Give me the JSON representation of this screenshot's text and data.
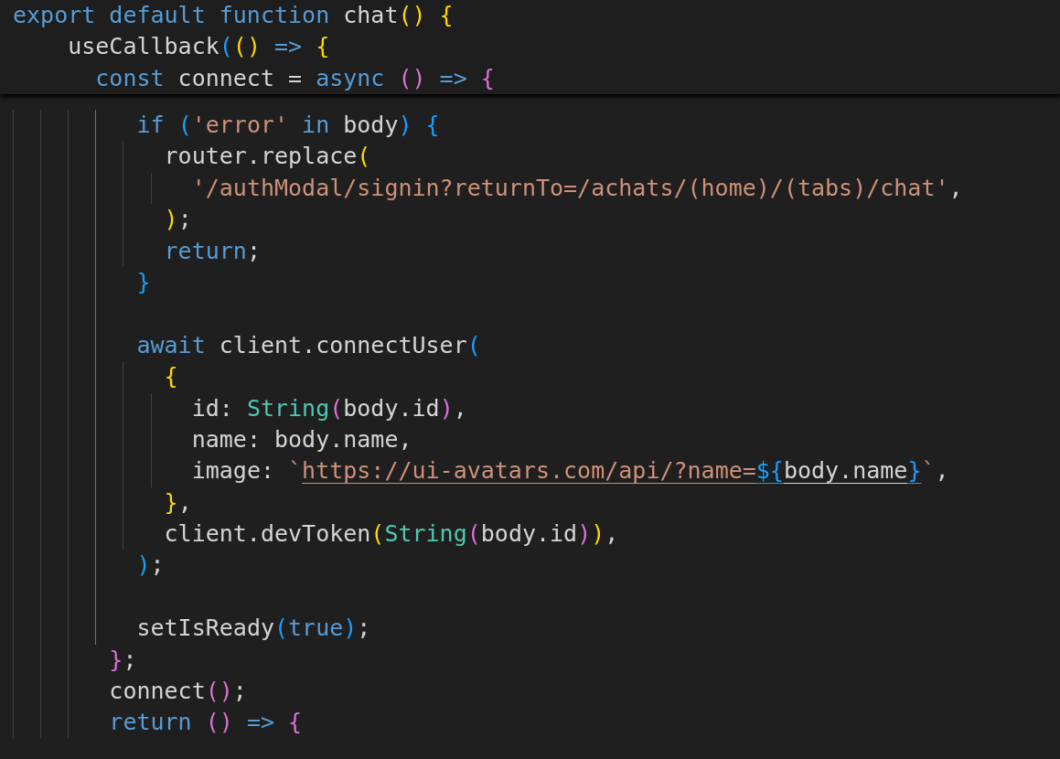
{
  "sticky_lines": [
    {
      "kind": "code",
      "tokens": [
        {
          "kind": "keyword",
          "t": "export default function "
        },
        {
          "kind": "plain",
          "t": "chat"
        },
        {
          "kind": "bracket1",
          "t": "() {"
        }
      ]
    },
    {
      "kind": "code",
      "tokens": [
        {
          "kind": "plain",
          "t": "    useCallback"
        },
        {
          "kind": "bracket3",
          "t": "("
        },
        {
          "kind": "bracket1",
          "t": "()"
        },
        {
          "kind": "keyword",
          "t": " => "
        },
        {
          "kind": "bracket1",
          "t": "{"
        }
      ]
    },
    {
      "kind": "code",
      "tokens": [
        {
          "kind": "keyword",
          "t": "      const "
        },
        {
          "kind": "plain",
          "t": "connect = "
        },
        {
          "kind": "keyword",
          "t": "async "
        },
        {
          "kind": "bracket2",
          "t": "() "
        },
        {
          "kind": "keyword",
          "t": "=> "
        },
        {
          "kind": "bracket2",
          "t": "{"
        }
      ]
    }
  ],
  "code_lines": [
    {
      "kind": "code",
      "tokens": [
        {
          "kind": "keyword",
          "t": "        if "
        },
        {
          "kind": "bracket3",
          "t": "("
        },
        {
          "kind": "string",
          "t": "'error'"
        },
        {
          "kind": "keyword",
          "t": " in "
        },
        {
          "kind": "plain",
          "t": "body"
        },
        {
          "kind": "bracket3",
          "t": ") {"
        }
      ]
    },
    {
      "kind": "code",
      "tokens": [
        {
          "kind": "plain",
          "t": "          router.replace"
        },
        {
          "kind": "bracket1",
          "t": "("
        }
      ]
    },
    {
      "kind": "code",
      "tokens": [
        {
          "kind": "string",
          "t": "            '/authModal/signin?returnTo=/achats/(home)/(tabs)/chat'"
        },
        {
          "kind": "plain",
          "t": ","
        }
      ]
    },
    {
      "kind": "code",
      "tokens": [
        {
          "kind": "bracket1",
          "t": "          )"
        },
        {
          "kind": "plain",
          "t": ";"
        }
      ]
    },
    {
      "kind": "code",
      "tokens": [
        {
          "kind": "keyword",
          "t": "          return"
        },
        {
          "kind": "plain",
          "t": ";"
        }
      ]
    },
    {
      "kind": "code",
      "tokens": [
        {
          "kind": "bracket3",
          "t": "        }"
        }
      ]
    },
    {
      "kind": "blank"
    },
    {
      "kind": "code",
      "tokens": [
        {
          "kind": "keyword",
          "t": "        await "
        },
        {
          "kind": "plain",
          "t": "client.connectUser"
        },
        {
          "kind": "bracket3",
          "t": "("
        }
      ]
    },
    {
      "kind": "code",
      "tokens": [
        {
          "kind": "bracket1",
          "t": "          {"
        }
      ]
    },
    {
      "kind": "code",
      "tokens": [
        {
          "kind": "plain",
          "t": "            id: "
        },
        {
          "kind": "type",
          "t": "String"
        },
        {
          "kind": "bracket2",
          "t": "("
        },
        {
          "kind": "plain",
          "t": "body.id"
        },
        {
          "kind": "bracket2",
          "t": ")"
        },
        {
          "kind": "plain",
          "t": ","
        }
      ]
    },
    {
      "kind": "code",
      "tokens": [
        {
          "kind": "plain",
          "t": "            name: body.name,"
        }
      ]
    },
    {
      "kind": "code",
      "tokens": [
        {
          "kind": "plain",
          "t": "            image: "
        },
        {
          "kind": "string",
          "t": "`"
        },
        {
          "kind": "string",
          "t": "https://ui-avatars.com/api/?name=",
          "link": true
        },
        {
          "kind": "bracket3",
          "t": "${",
          "link": true
        },
        {
          "kind": "plain",
          "t": "body.name",
          "link": true
        },
        {
          "kind": "bracket3",
          "t": "}",
          "link": true
        },
        {
          "kind": "string",
          "t": "`"
        },
        {
          "kind": "plain",
          "t": ","
        }
      ]
    },
    {
      "kind": "code",
      "tokens": [
        {
          "kind": "bracket1",
          "t": "          }"
        },
        {
          "kind": "plain",
          "t": ","
        }
      ]
    },
    {
      "kind": "code",
      "tokens": [
        {
          "kind": "plain",
          "t": "          client.devToken"
        },
        {
          "kind": "bracket1",
          "t": "("
        },
        {
          "kind": "type",
          "t": "String"
        },
        {
          "kind": "bracket2",
          "t": "("
        },
        {
          "kind": "plain",
          "t": "body.id"
        },
        {
          "kind": "bracket2",
          "t": ")"
        },
        {
          "kind": "bracket1",
          "t": ")"
        },
        {
          "kind": "plain",
          "t": ","
        }
      ]
    },
    {
      "kind": "code",
      "tokens": [
        {
          "kind": "bracket3",
          "t": "        )"
        },
        {
          "kind": "plain",
          "t": ";"
        }
      ]
    },
    {
      "kind": "blank"
    },
    {
      "kind": "code",
      "tokens": [
        {
          "kind": "plain",
          "t": "        setIsReady"
        },
        {
          "kind": "bracket3",
          "t": "("
        },
        {
          "kind": "keyword",
          "t": "true"
        },
        {
          "kind": "bracket3",
          "t": ")"
        },
        {
          "kind": "plain",
          "t": ";"
        }
      ]
    },
    {
      "kind": "code",
      "tokens": [
        {
          "kind": "bracket2",
          "t": "      }"
        },
        {
          "kind": "plain",
          "t": ";"
        }
      ]
    },
    {
      "kind": "code",
      "tokens": [
        {
          "kind": "plain",
          "t": "      connect"
        },
        {
          "kind": "bracket2",
          "t": "()"
        },
        {
          "kind": "plain",
          "t": ";"
        }
      ]
    },
    {
      "kind": "code",
      "tokens": [
        {
          "kind": "keyword",
          "t": "      return "
        },
        {
          "kind": "bracket2",
          "t": "() "
        },
        {
          "kind": "keyword",
          "t": "=> "
        },
        {
          "kind": "bracket2",
          "t": "{"
        }
      ]
    }
  ]
}
